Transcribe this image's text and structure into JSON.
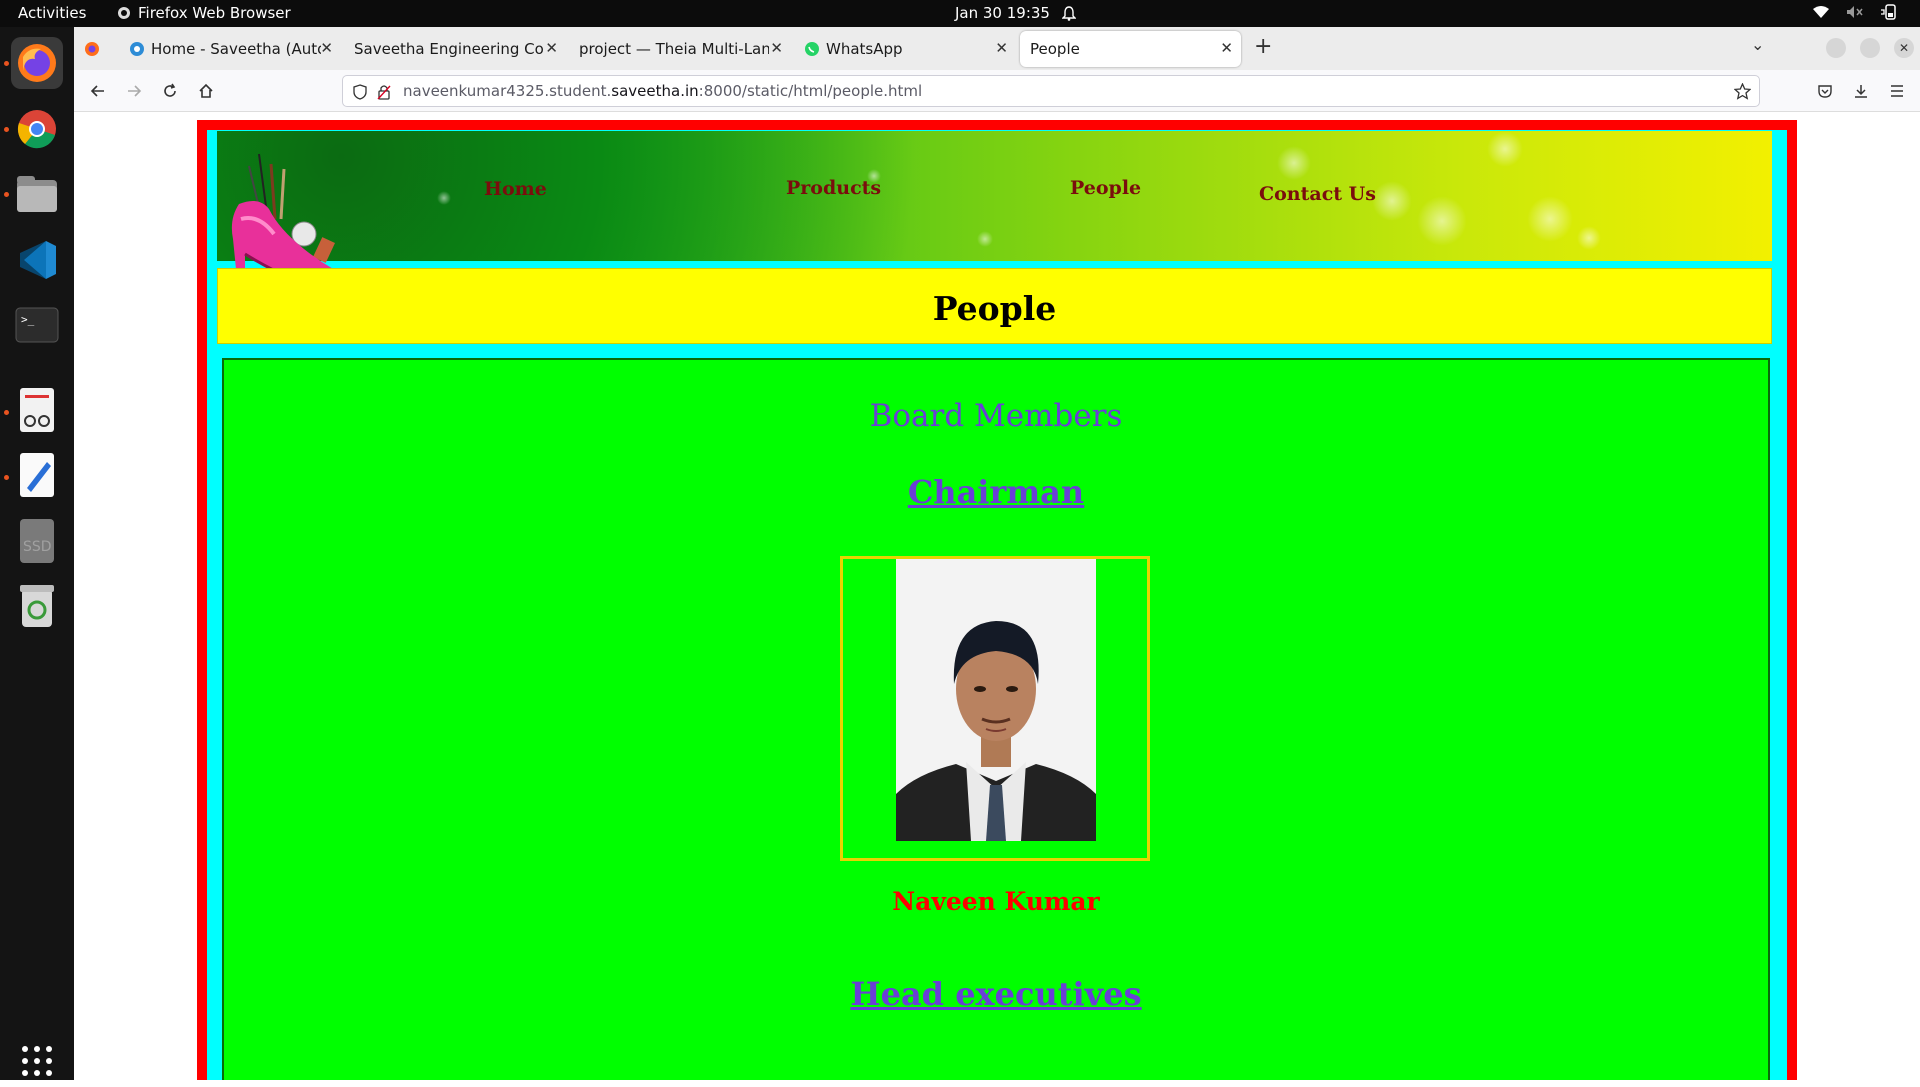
{
  "system": {
    "activities": "Activities",
    "app_name": "Firefox Web Browser",
    "clock": "Jan 30  19:35"
  },
  "browser": {
    "tabs": [
      {
        "title": "Home - Saveetha (Autono"
      },
      {
        "title": "Saveetha Engineering Colleg"
      },
      {
        "title": "project — Theia Multi-Langu"
      },
      {
        "title": "WhatsApp"
      },
      {
        "title": "People"
      }
    ],
    "url_prefix": "naveenkumar4325.student.",
    "url_domain": "saveetha.in",
    "url_suffix": ":8000/static/html/people.html"
  },
  "page": {
    "nav": [
      "Home",
      "Products",
      "People",
      "Contact Us"
    ],
    "title": "People",
    "board_heading": "Board Members",
    "chairman_heading": "Chairman",
    "chairman_name": "Naveen Kumar",
    "head_exec_heading": "Head executives"
  },
  "colors": {
    "frame": "#ff0000",
    "inner": "#00ffff",
    "title_bar": "#ffff00",
    "content_bg": "#00ff00",
    "heading": "#6a3fd6",
    "nav_link": "#7a0d0d"
  }
}
